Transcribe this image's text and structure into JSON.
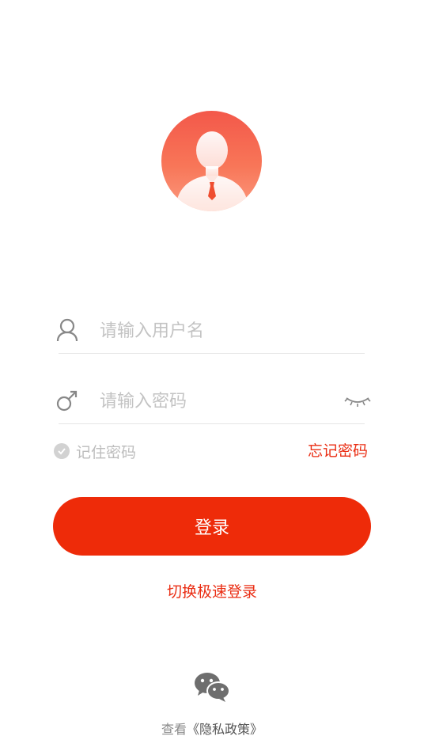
{
  "avatar": {
    "icon": "user-avatar-icon"
  },
  "username": {
    "placeholder": "请输入用户名",
    "value": "",
    "icon": "person-icon"
  },
  "password": {
    "placeholder": "请输入密码",
    "value": "",
    "icon": "key-icon",
    "visibility_icon": "eye-closed-icon"
  },
  "remember": {
    "label": "记住密码",
    "checked": false
  },
  "forgot": {
    "label": "忘记密码"
  },
  "login_button": {
    "label": "登录"
  },
  "switch_link": {
    "label": "切换极速登录"
  },
  "wechat": {
    "icon": "wechat-icon"
  },
  "privacy": {
    "prefix": "查看",
    "link": "《隐私政策》"
  },
  "colors": {
    "accent": "#ee2b09",
    "link": "#ea2d13",
    "avatar_top": "#f3584a",
    "avatar_bottom": "#fb9a7f"
  }
}
